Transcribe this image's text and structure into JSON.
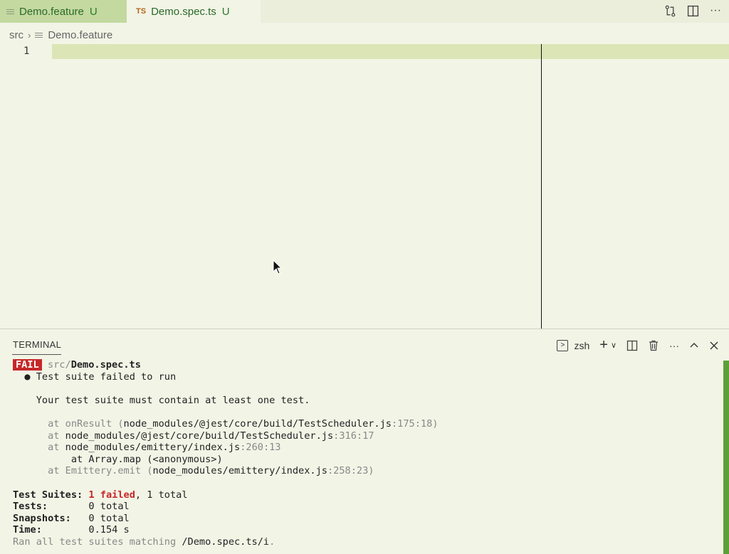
{
  "tabs": [
    {
      "label": "Demo.feature",
      "status": "U",
      "icon": "file-lines-icon",
      "active": true
    },
    {
      "label": "Demo.spec.ts",
      "status": "U",
      "icon": "TS",
      "active": false
    }
  ],
  "breadcrumb": {
    "folder": "src",
    "file": "Demo.feature"
  },
  "editor": {
    "line_number": "1"
  },
  "terminal": {
    "title": "TERMINAL",
    "shell": "zsh",
    "fail_badge": "FAIL",
    "file_dir": "src/",
    "file_name": "Demo.spec.ts",
    "error_title": "● Test suite failed to run",
    "error_message": "Your test suite must contain at least one test.",
    "stack": [
      {
        "prefix": "at onResult (",
        "path": "node_modules/@jest/core/build/TestScheduler.js",
        "loc": ":175:18)"
      },
      {
        "prefix": "at ",
        "path": "node_modules/@jest/core/build/TestScheduler.js",
        "loc": ":316:17"
      },
      {
        "prefix": "at ",
        "path": "node_modules/emittery/index.js",
        "loc": ":260:13"
      },
      {
        "prefix": "",
        "path": "    at Array.map (<anonymous>)",
        "loc": ""
      },
      {
        "prefix": "at Emittery.emit (",
        "path": "node_modules/emittery/index.js",
        "loc": ":258:23)"
      }
    ],
    "summary": {
      "suites_label": "Test Suites: ",
      "suites_failed": "1 failed",
      "suites_rest": ", 1 total",
      "tests_label": "Tests:       ",
      "tests_value": "0 total",
      "snapshots_label": "Snapshots:   ",
      "snapshots_value": "0 total",
      "time_label": "Time:        ",
      "time_value": "0.154 s",
      "ran_label": "Ran all test suites matching ",
      "ran_pattern": "/Demo.spec.ts/i",
      "ran_end": "."
    }
  }
}
